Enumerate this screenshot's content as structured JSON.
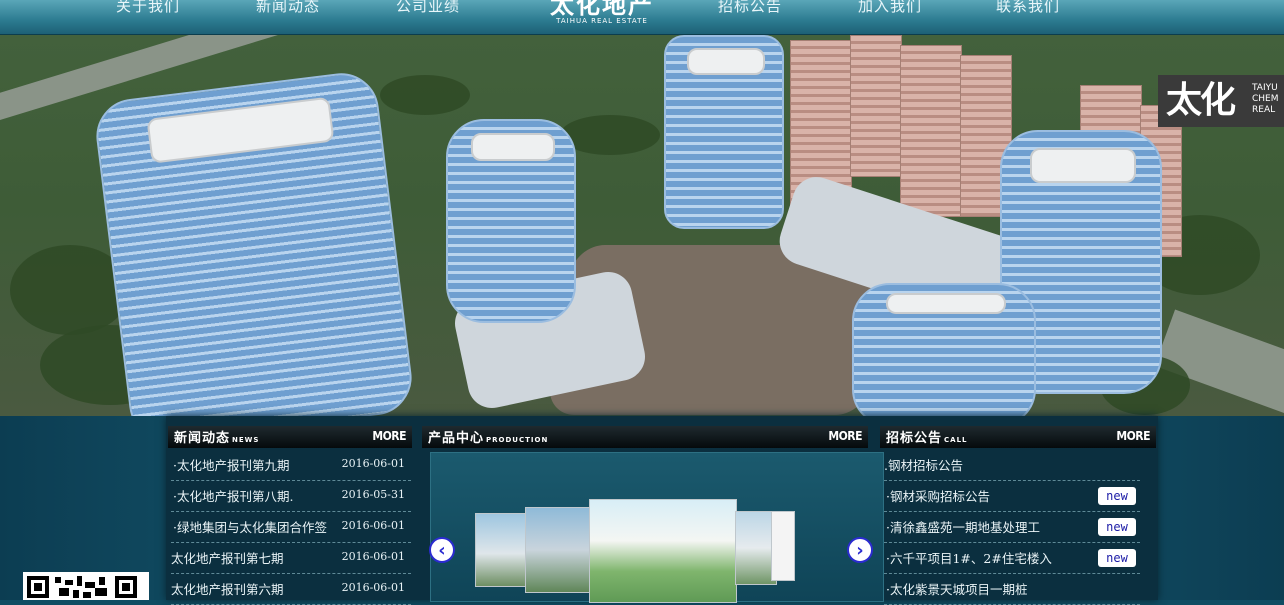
{
  "nav": {
    "items": [
      "关于我们",
      "新闻动态",
      "公司业绩",
      "招标公告",
      "加入我们",
      "联系我们"
    ],
    "logo_cn": "太化地产",
    "logo_en": "TAIHUA REAL ESTATE"
  },
  "hero": {
    "badge_cn": "太化",
    "badge_en_lines": [
      "TAIYU",
      "CHEM",
      "REAL"
    ]
  },
  "news": {
    "title": "新闻动态",
    "subtitle": "NEWS",
    "more": "MORE",
    "items": [
      {
        "title": "·太化地产报刊第九期",
        "date": "2016-06-01"
      },
      {
        "title": "·太化地产报刊第八期.",
        "date": "2016-05-31"
      },
      {
        "title": "·绿地集团与太化集团合作签",
        "date": "2016-06-01"
      },
      {
        "title": "太化地产报刊第七期",
        "date": "2016-06-01"
      },
      {
        "title": "太化地产报刊第六期",
        "date": "2016-06-01"
      }
    ]
  },
  "products": {
    "title": "产品中心",
    "subtitle": "PRODUCTION",
    "more": "MORE",
    "prev": "‹",
    "next": "›"
  },
  "call": {
    "title": "招标公告",
    "subtitle": "CALL",
    "more": "MORE",
    "new_label": "new",
    "items": [
      {
        "title": ".钢材招标公告",
        "new": false
      },
      {
        "title": "·钢材采购招标公告",
        "new": true
      },
      {
        "title": "·清徐鑫盛苑一期地基处理工",
        "new": true
      },
      {
        "title": "·六千平项目1#、2#住宅楼入",
        "new": true
      },
      {
        "title": "·太化紫景天城项目一期桩",
        "new": false
      }
    ]
  },
  "colors": {
    "accent_blue": "#2b2bd0",
    "nav_teal": "#2c7b90"
  }
}
